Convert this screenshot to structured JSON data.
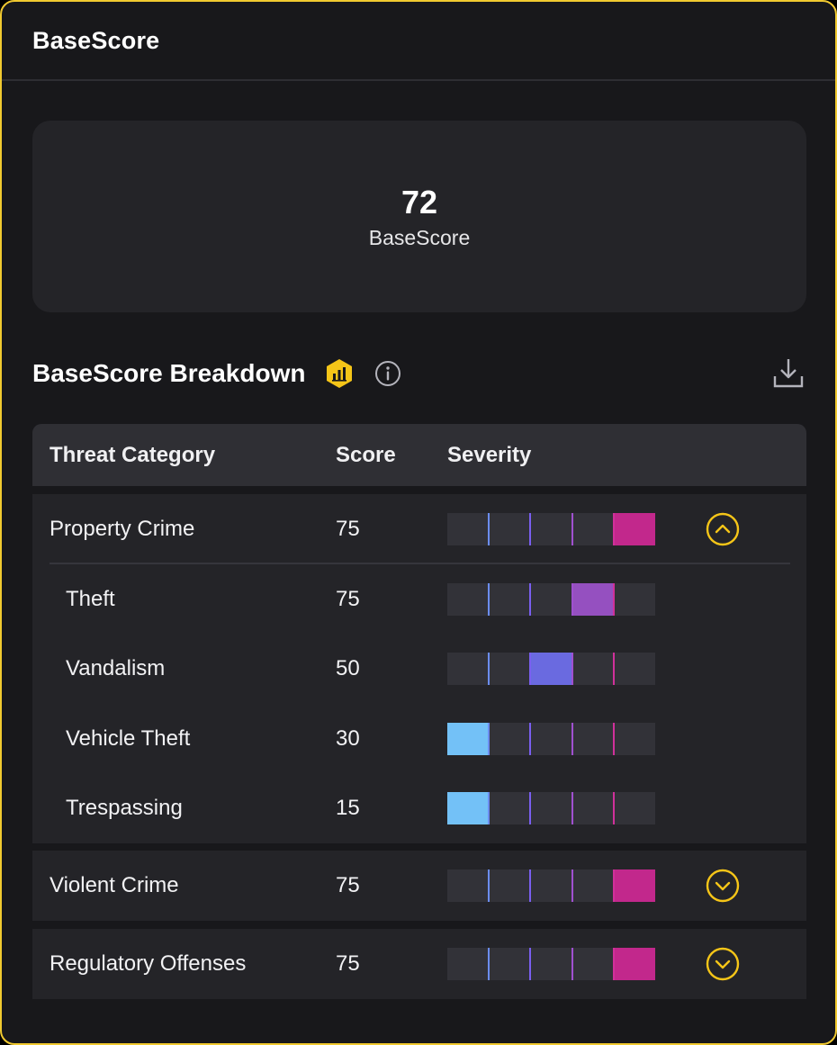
{
  "header": {
    "title": "BaseScore"
  },
  "score_card": {
    "value": "72",
    "label": "BaseScore"
  },
  "breakdown": {
    "title": "BaseScore Breakdown"
  },
  "icons": {
    "badge": "bar-chart-hexagon-icon",
    "info": "info-icon",
    "download": "download-icon",
    "expand": "chevron-down-circle-icon",
    "collapse": "chevron-up-circle-icon"
  },
  "colors": {
    "accent": "#f5c518",
    "seg_empty": "#323238",
    "level1": "#73c1f7",
    "level2": "#6a6ae0",
    "level3": "#9550c0",
    "level4": "#c2288c",
    "tick1": "#6b8df0",
    "tick2": "#7a5ff0",
    "tick3": "#a050d0",
    "tick4": "#d0309a"
  },
  "table": {
    "columns": [
      "Threat Category",
      "Score",
      "Severity"
    ],
    "groups": [
      {
        "name": "Property Crime",
        "score": "75",
        "level": 5,
        "expanded": true,
        "children": [
          {
            "name": "Theft",
            "score": "75",
            "level": 4
          },
          {
            "name": "Vandalism",
            "score": "50",
            "level": 3
          },
          {
            "name": "Vehicle Theft",
            "score": "30",
            "level": 1
          },
          {
            "name": "Trespassing",
            "score": "15",
            "level": 1
          }
        ]
      },
      {
        "name": "Violent Crime",
        "score": "75",
        "level": 5,
        "expanded": false,
        "children": []
      },
      {
        "name": "Regulatory Offenses",
        "score": "75",
        "level": 5,
        "expanded": false,
        "children": []
      }
    ]
  }
}
